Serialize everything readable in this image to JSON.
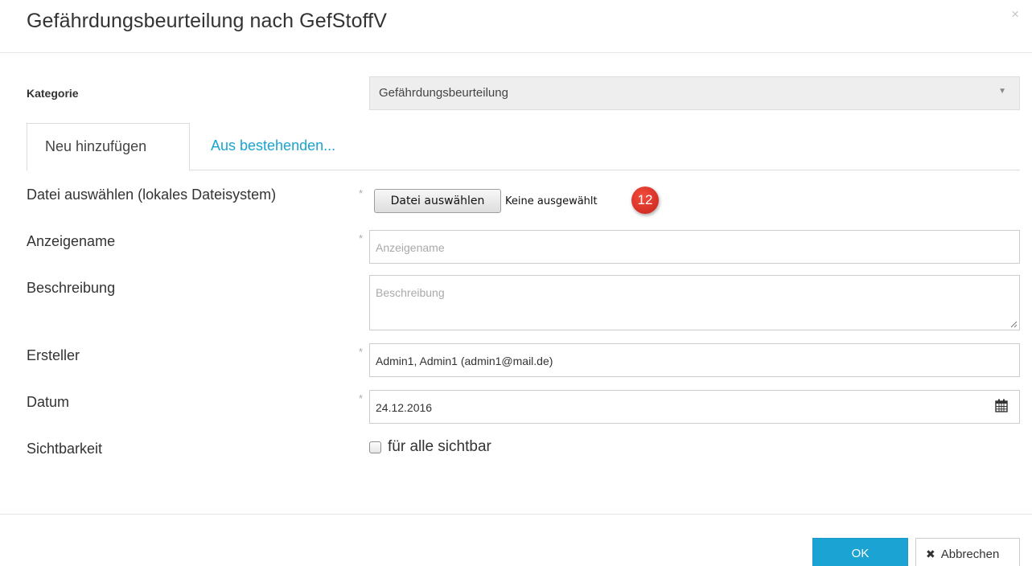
{
  "dialog": {
    "title": "Gefährdungsbeurteilung nach GefStoffV",
    "close_icon": "×"
  },
  "category": {
    "label": "Kategorie",
    "value": "Gefährdungsbeurteilung",
    "caret": "▼"
  },
  "tabs": [
    {
      "label": "Neu hinzufügen",
      "active": true
    },
    {
      "label": "Aus bestehenden...",
      "active": false
    }
  ],
  "form": {
    "required_mark": "*",
    "file": {
      "label": "Datei auswählen (lokales Dateisystem)",
      "button_label": "Datei auswählen",
      "status": "Keine ausgewählt",
      "badge": "12"
    },
    "display_name": {
      "label": "Anzeigename",
      "placeholder": "Anzeigename",
      "value": ""
    },
    "description": {
      "label": "Beschreibung",
      "placeholder": "Beschreibung",
      "value": ""
    },
    "creator": {
      "label": "Ersteller",
      "value": "Admin1, Admin1 (admin1@mail.de)"
    },
    "date": {
      "label": "Datum",
      "value": "24.12.2016",
      "icon": "calendar-icon"
    },
    "visibility": {
      "label": "Sichtbarkeit",
      "checkbox_label": "für alle sichtbar",
      "checked": false
    }
  },
  "footer": {
    "ok_label": "OK",
    "cancel_label": "Abbrechen",
    "cancel_icon": "✖"
  },
  "colors": {
    "accent": "#1aa3d3",
    "badge": "#d9302a",
    "select_bg": "#eeeeee"
  }
}
